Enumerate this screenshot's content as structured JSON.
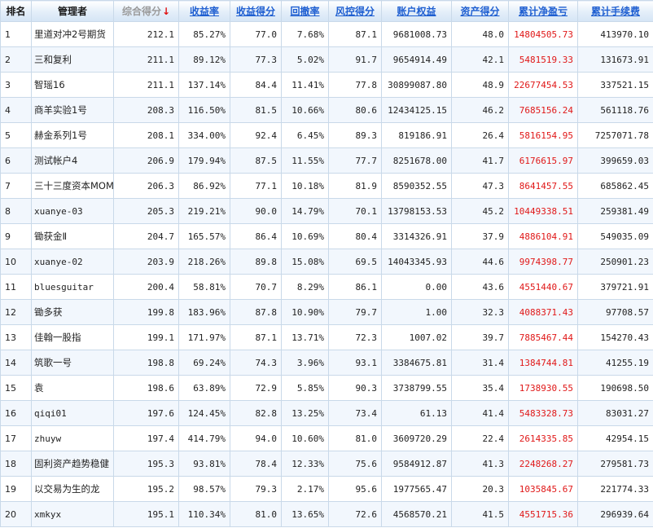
{
  "table": {
    "headers": [
      {
        "key": "rank",
        "label": "排名",
        "sortable": false
      },
      {
        "key": "manager",
        "label": "管理者",
        "sortable": false
      },
      {
        "key": "total_score",
        "label": "综合得分",
        "sortable": true,
        "active": true,
        "arrow": "↓"
      },
      {
        "key": "return_rate",
        "label": "收益率",
        "sortable": true
      },
      {
        "key": "return_score",
        "label": "收益得分",
        "sortable": true
      },
      {
        "key": "drawdown",
        "label": "回撤率",
        "sortable": true
      },
      {
        "key": "risk_score",
        "label": "风控得分",
        "sortable": true
      },
      {
        "key": "equity",
        "label": "账户权益",
        "sortable": true
      },
      {
        "key": "asset_score",
        "label": "资产得分",
        "sortable": true
      },
      {
        "key": "cum_profit",
        "label": "累计净盈亏",
        "sortable": true
      },
      {
        "key": "cum_fee",
        "label": "累计手续费",
        "sortable": true
      }
    ],
    "rows": [
      {
        "rank": "1",
        "manager": "里道对冲2号期货",
        "total_score": "212.1",
        "return_rate": "85.27%",
        "return_score": "77.0",
        "drawdown": "7.68%",
        "risk_score": "87.1",
        "equity": "9681008.73",
        "asset_score": "48.0",
        "cum_profit": "14804505.73",
        "cum_fee": "413970.10"
      },
      {
        "rank": "2",
        "manager": "三和复利",
        "total_score": "211.1",
        "return_rate": "89.12%",
        "return_score": "77.3",
        "drawdown": "5.02%",
        "risk_score": "91.7",
        "equity": "9654914.49",
        "asset_score": "42.1",
        "cum_profit": "5481519.33",
        "cum_fee": "131673.91"
      },
      {
        "rank": "3",
        "manager": "智瑶16",
        "total_score": "211.1",
        "return_rate": "137.14%",
        "return_score": "84.4",
        "drawdown": "11.41%",
        "risk_score": "77.8",
        "equity": "30899087.80",
        "asset_score": "48.9",
        "cum_profit": "22677454.53",
        "cum_fee": "337521.15"
      },
      {
        "rank": "4",
        "manager": "商羊实验1号",
        "total_score": "208.3",
        "return_rate": "116.50%",
        "return_score": "81.5",
        "drawdown": "10.66%",
        "risk_score": "80.6",
        "equity": "12434125.15",
        "asset_score": "46.2",
        "cum_profit": "7685156.24",
        "cum_fee": "561118.76"
      },
      {
        "rank": "5",
        "manager": "赫金系列1号",
        "total_score": "208.1",
        "return_rate": "334.00%",
        "return_score": "92.4",
        "drawdown": "6.45%",
        "risk_score": "89.3",
        "equity": "819186.91",
        "asset_score": "26.4",
        "cum_profit": "5816154.95",
        "cum_fee": "7257071.78"
      },
      {
        "rank": "6",
        "manager": "测试帐户4",
        "total_score": "206.9",
        "return_rate": "179.94%",
        "return_score": "87.5",
        "drawdown": "11.55%",
        "risk_score": "77.7",
        "equity": "8251678.00",
        "asset_score": "41.7",
        "cum_profit": "6176615.97",
        "cum_fee": "399659.03"
      },
      {
        "rank": "7",
        "manager": "三十三度资本MOM",
        "total_score": "206.3",
        "return_rate": "86.92%",
        "return_score": "77.1",
        "drawdown": "10.18%",
        "risk_score": "81.9",
        "equity": "8590352.55",
        "asset_score": "47.3",
        "cum_profit": "8641457.55",
        "cum_fee": "685862.45"
      },
      {
        "rank": "8",
        "manager": "xuanye-03",
        "total_score": "205.3",
        "return_rate": "219.21%",
        "return_score": "90.0",
        "drawdown": "14.79%",
        "risk_score": "70.1",
        "equity": "13798153.53",
        "asset_score": "45.2",
        "cum_profit": "10449338.51",
        "cum_fee": "259381.49"
      },
      {
        "rank": "9",
        "manager": "锄获金Ⅱ",
        "total_score": "204.7",
        "return_rate": "165.57%",
        "return_score": "86.4",
        "drawdown": "10.69%",
        "risk_score": "80.4",
        "equity": "3314326.91",
        "asset_score": "37.9",
        "cum_profit": "4886104.91",
        "cum_fee": "549035.09"
      },
      {
        "rank": "10",
        "manager": "xuanye-02",
        "total_score": "203.9",
        "return_rate": "218.26%",
        "return_score": "89.8",
        "drawdown": "15.08%",
        "risk_score": "69.5",
        "equity": "14043345.93",
        "asset_score": "44.6",
        "cum_profit": "9974398.77",
        "cum_fee": "250901.23"
      },
      {
        "rank": "11",
        "manager": "bluesguitar",
        "total_score": "200.4",
        "return_rate": "58.81%",
        "return_score": "70.7",
        "drawdown": "8.29%",
        "risk_score": "86.1",
        "equity": "0.00",
        "asset_score": "43.6",
        "cum_profit": "4551440.67",
        "cum_fee": "379721.91"
      },
      {
        "rank": "12",
        "manager": "锄多获",
        "total_score": "199.8",
        "return_rate": "183.96%",
        "return_score": "87.8",
        "drawdown": "10.90%",
        "risk_score": "79.7",
        "equity": "1.00",
        "asset_score": "32.3",
        "cum_profit": "4088371.43",
        "cum_fee": "97708.57"
      },
      {
        "rank": "13",
        "manager": "佳翰一股指",
        "total_score": "199.1",
        "return_rate": "171.97%",
        "return_score": "87.1",
        "drawdown": "13.71%",
        "risk_score": "72.3",
        "equity": "1007.02",
        "asset_score": "39.7",
        "cum_profit": "7885467.44",
        "cum_fee": "154270.43"
      },
      {
        "rank": "14",
        "manager": "筑歌一号",
        "total_score": "198.8",
        "return_rate": "69.24%",
        "return_score": "74.3",
        "drawdown": "3.96%",
        "risk_score": "93.1",
        "equity": "3384675.81",
        "asset_score": "31.4",
        "cum_profit": "1384744.81",
        "cum_fee": "41255.19"
      },
      {
        "rank": "15",
        "manager": "袁",
        "total_score": "198.6",
        "return_rate": "63.89%",
        "return_score": "72.9",
        "drawdown": "5.85%",
        "risk_score": "90.3",
        "equity": "3738799.55",
        "asset_score": "35.4",
        "cum_profit": "1738930.55",
        "cum_fee": "190698.50"
      },
      {
        "rank": "16",
        "manager": "qiqi01",
        "total_score": "197.6",
        "return_rate": "124.45%",
        "return_score": "82.8",
        "drawdown": "13.25%",
        "risk_score": "73.4",
        "equity": "61.13",
        "asset_score": "41.4",
        "cum_profit": "5483328.73",
        "cum_fee": "83031.27"
      },
      {
        "rank": "17",
        "manager": "zhuyw",
        "total_score": "197.4",
        "return_rate": "414.79%",
        "return_score": "94.0",
        "drawdown": "10.60%",
        "risk_score": "81.0",
        "equity": "3609720.29",
        "asset_score": "22.4",
        "cum_profit": "2614335.85",
        "cum_fee": "42954.15"
      },
      {
        "rank": "18",
        "manager": "固利资产趋势稳健",
        "total_score": "195.3",
        "return_rate": "93.81%",
        "return_score": "78.4",
        "drawdown": "12.33%",
        "risk_score": "75.6",
        "equity": "9584912.87",
        "asset_score": "41.3",
        "cum_profit": "2248268.27",
        "cum_fee": "279581.73"
      },
      {
        "rank": "19",
        "manager": "以交易为生的龙",
        "total_score": "195.2",
        "return_rate": "98.57%",
        "return_score": "79.3",
        "drawdown": "2.17%",
        "risk_score": "95.6",
        "equity": "1977565.47",
        "asset_score": "20.3",
        "cum_profit": "1035845.67",
        "cum_fee": "221774.33"
      },
      {
        "rank": "20",
        "manager": "xmkyx",
        "total_score": "195.1",
        "return_rate": "110.34%",
        "return_score": "81.0",
        "drawdown": "13.65%",
        "risk_score": "72.6",
        "equity": "4568570.21",
        "asset_score": "41.5",
        "cum_profit": "4551715.36",
        "cum_fee": "296939.64"
      }
    ]
  },
  "colors": {
    "header_bg": "#e3eef9",
    "sort_link": "#1f5fd1",
    "active_sort": "#9a9a9a",
    "sort_arrow": "#e01010",
    "profit": "#e01818",
    "grid": "#c9d9e9",
    "row_alt": "#f2f7fd"
  }
}
